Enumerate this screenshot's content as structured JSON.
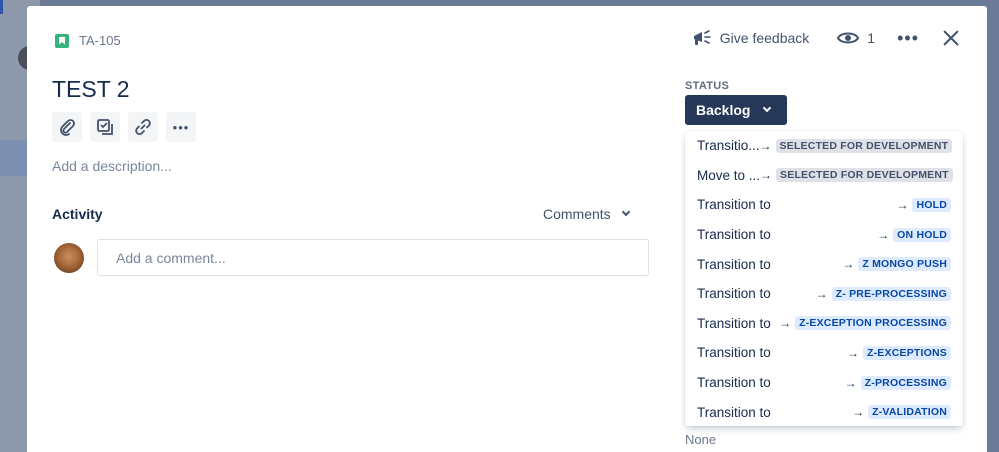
{
  "issue": {
    "key": "TA-105",
    "title": "TEST 2",
    "description_placeholder": "Add a description..."
  },
  "header": {
    "feedback_label": "Give feedback",
    "watch_count": "1",
    "more_label": "•••"
  },
  "toolbar": {
    "more_label": "•••"
  },
  "activity": {
    "label": "Activity",
    "filter_label": "Comments",
    "comment_placeholder": "Add a comment..."
  },
  "status": {
    "label": "STATUS",
    "current": "Backlog"
  },
  "transitions": [
    {
      "text": "Transitio...",
      "target": "SELECTED FOR DEVELOPMENT",
      "style": "grey"
    },
    {
      "text": "Move to ...",
      "target": "SELECTED FOR DEVELOPMENT",
      "style": "grey"
    },
    {
      "text": "Transition to",
      "target": "HOLD",
      "style": "blue"
    },
    {
      "text": "Transition to",
      "target": "ON HOLD",
      "style": "blue"
    },
    {
      "text": "Transition to",
      "target": "Z MONGO PUSH",
      "style": "blue"
    },
    {
      "text": "Transition to",
      "target": "Z- PRE-PROCESSING",
      "style": "blue"
    },
    {
      "text": "Transition to",
      "target": "Z-EXCEPTION PROCESSING",
      "style": "blue"
    },
    {
      "text": "Transition to",
      "target": "Z-EXCEPTIONS",
      "style": "blue"
    },
    {
      "text": "Transition to",
      "target": "Z-PROCESSING",
      "style": "blue"
    },
    {
      "text": "Transition to",
      "target": "Z-VALIDATION",
      "style": "blue"
    }
  ],
  "below_dropdown": {
    "none_label": "None"
  },
  "colors": {
    "status_button": "#253858",
    "lozenge_grey_bg": "#dfe1e6",
    "lozenge_blue_bg": "#deebff",
    "story_icon": "#36b37e"
  }
}
